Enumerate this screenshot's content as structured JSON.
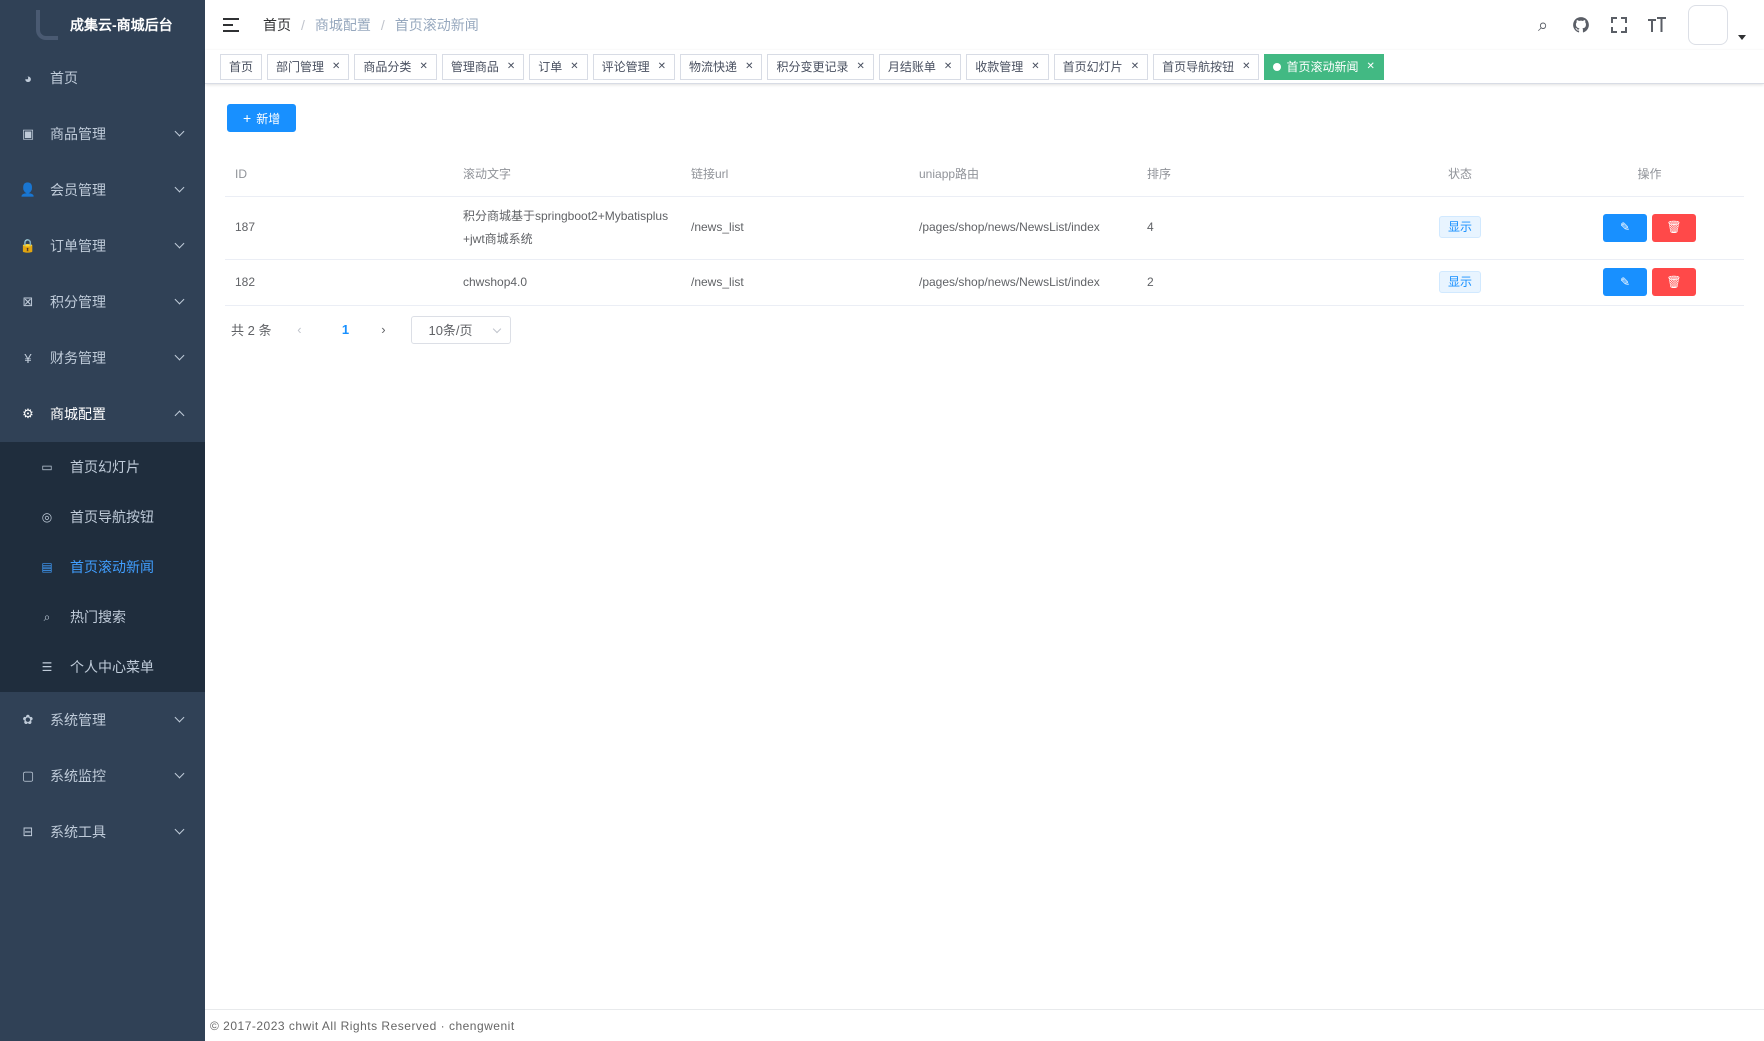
{
  "app": {
    "logo_text": "成集云-商城后台"
  },
  "sidebar": {
    "items": [
      {
        "label": "首页",
        "icon": "dashboard-icon"
      },
      {
        "label": "商品管理",
        "icon": "shopping-icon"
      },
      {
        "label": "会员管理",
        "icon": "peoples-icon"
      },
      {
        "label": "订单管理",
        "icon": "lock-icon"
      },
      {
        "label": "积分管理",
        "icon": "points-icon"
      },
      {
        "label": "财务管理",
        "icon": "money-icon"
      },
      {
        "label": "商城配置",
        "icon": "gear-icon"
      },
      {
        "label": "系统管理",
        "icon": "system-icon"
      },
      {
        "label": "系统监控",
        "icon": "monitor-icon"
      },
      {
        "label": "系统工具",
        "icon": "tool-icon"
      }
    ],
    "submenu": [
      {
        "label": "首页幻灯片",
        "icon": "slides-icon"
      },
      {
        "label": "首页导航按钮",
        "icon": "nav-button-icon"
      },
      {
        "label": "首页滚动新闻",
        "icon": "news-icon"
      },
      {
        "label": "热门搜索",
        "icon": "search-icon"
      },
      {
        "label": "个人中心菜单",
        "icon": "list-icon"
      }
    ]
  },
  "breadcrumb": [
    "首页",
    "商城配置",
    "首页滚动新闻"
  ],
  "tags": [
    "首页",
    "部门管理",
    "商品分类",
    "管理商品",
    "订单",
    "评论管理",
    "物流快递",
    "积分变更记录",
    "月结账单",
    "收款管理",
    "首页幻灯片",
    "首页导航按钮",
    "首页滚动新闻"
  ],
  "toolbar": {
    "add_label": "新增"
  },
  "table": {
    "headers": [
      "ID",
      "滚动文字",
      "链接url",
      "uniapp路由",
      "排序",
      "状态",
      "操作"
    ],
    "rows": [
      {
        "id": "187",
        "text_line1": "积分商城基于springboot2+Mybatisplus",
        "text_line2": "+jwt商城系统",
        "url": "/news_list",
        "route": "/pages/shop/news/NewsList/index",
        "sort": "4",
        "status": "显示"
      },
      {
        "id": "182",
        "text_line1": "chwshop4.0",
        "text_line2": "",
        "url": "/news_list",
        "route": "/pages/shop/news/NewsList/index",
        "sort": "2",
        "status": "显示"
      }
    ]
  },
  "pagination": {
    "total": "共 2 条",
    "current": "1",
    "page_size": "10条/页"
  },
  "footer": {
    "text": "© 2017-2023 chwit All Rights Reserved · chengwenit"
  },
  "colors": {
    "sidebar": "#304156",
    "submenu": "#1f2d3d",
    "primary": "#1890ff",
    "danger": "#ff4949",
    "tag_active": "#42b983"
  }
}
